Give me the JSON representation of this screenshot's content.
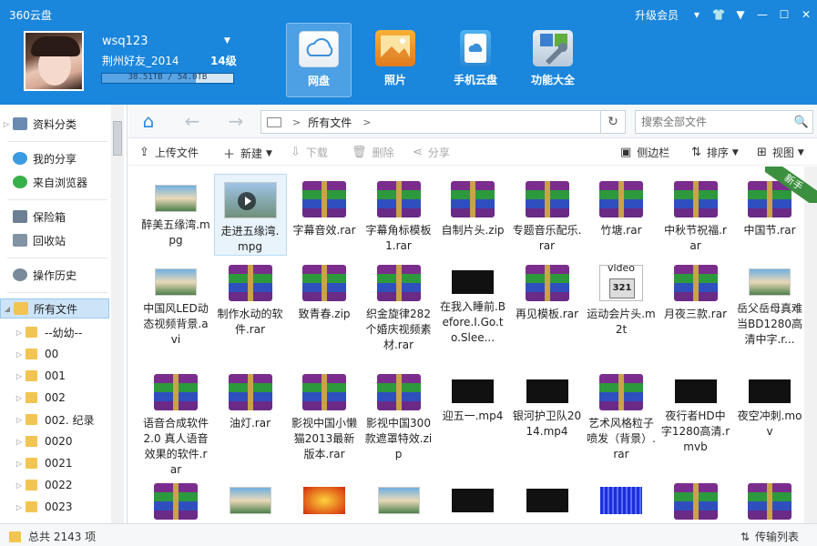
{
  "window": {
    "title": "360云盘",
    "vip_label": "升级会员"
  },
  "colors": {
    "header": "#1a86dc",
    "selection": "#cce4f7"
  },
  "user": {
    "name": "wsq123",
    "group": "荆州好友_2014",
    "level": "14级",
    "quota_text": "38.51TB / 54.0TB",
    "quota_fraction": 0.713
  },
  "main_tabs": [
    {
      "label": "网盘",
      "icon": "cloud-disk-icon",
      "active": true
    },
    {
      "label": "照片",
      "icon": "photo-icon",
      "active": false
    },
    {
      "label": "手机云盘",
      "icon": "phone-cloud-icon",
      "active": false
    },
    {
      "label": "功能大全",
      "icon": "tools-icon",
      "active": false
    }
  ],
  "sidebar": {
    "items": [
      {
        "label": "资料分类",
        "icon": "category-icon"
      },
      {
        "label": "我的分享",
        "icon": "share-icon"
      },
      {
        "label": "来自浏览器",
        "icon": "browser-icon"
      },
      {
        "label": "保险箱",
        "icon": "safe-icon"
      },
      {
        "label": "回收站",
        "icon": "recycle-bin-icon"
      },
      {
        "label": "操作历史",
        "icon": "history-icon"
      },
      {
        "label": "所有文件",
        "icon": "all-files-icon",
        "selected": true
      }
    ],
    "folders": [
      "--幼幼--",
      "00",
      "001",
      "002",
      "002. 纪录",
      "0020",
      "0021",
      "0022",
      "0023"
    ]
  },
  "nav": {
    "path": "所有文件",
    "search_placeholder": "搜索全部文件"
  },
  "toolbar": {
    "upload": "上传文件",
    "new": "新建",
    "download": "下载",
    "delete": "删除",
    "share": "分享",
    "sidebar": "侧边栏",
    "sort": "排序",
    "view": "视图"
  },
  "ribbon": "新手",
  "files": [
    {
      "name": "醉美五缘湾.mpg",
      "thumb": "image"
    },
    {
      "name": "走进五缘湾.mpg",
      "thumb": "video",
      "selected": true
    },
    {
      "name": "字幕音效.rar",
      "thumb": "rar"
    },
    {
      "name": "字幕角标模板1.rar",
      "thumb": "rar"
    },
    {
      "name": "自制片头.zip",
      "thumb": "rar"
    },
    {
      "name": "专题音乐配乐.rar",
      "thumb": "rar"
    },
    {
      "name": "竹塘.rar",
      "thumb": "rar"
    },
    {
      "name": "中秋节祝福.rar",
      "thumb": "rar"
    },
    {
      "name": "中国节.rar",
      "thumb": "rar"
    },
    {
      "name": "中国风LED动态视频背景.avi",
      "thumb": "image"
    },
    {
      "name": "制作水动的软件.rar",
      "thumb": "rar"
    },
    {
      "name": "致青春.zip",
      "thumb": "rar"
    },
    {
      "name": "织金旋律282个婚庆视频素材.rar",
      "thumb": "rar"
    },
    {
      "name": "在我入睡前.Before.I.Go.to.Slee...",
      "thumb": "dark"
    },
    {
      "name": "再见模板.rar",
      "thumb": "rar"
    },
    {
      "name": "运动会片头.m2t",
      "thumb": "video-file"
    },
    {
      "name": "月夜三款.rar",
      "thumb": "rar"
    },
    {
      "name": "岳父岳母真难当BD1280高清中字.r...",
      "thumb": "image"
    },
    {
      "name": "语音合成软件2.0 真人语音效果的软件.rar",
      "thumb": "rar"
    },
    {
      "name": "油灯.rar",
      "thumb": "rar"
    },
    {
      "name": "影视中国小懒猫2013最新版本.rar",
      "thumb": "rar"
    },
    {
      "name": "影视中国300款遮罩特效.zip",
      "thumb": "rar"
    },
    {
      "name": "迎五一.mp4",
      "thumb": "dark"
    },
    {
      "name": "银河护卫队2014.mp4",
      "thumb": "dark"
    },
    {
      "name": "艺术风格粒子喷发（背景）.rar",
      "thumb": "rar"
    },
    {
      "name": "夜行者HD中字1280高清.rmvb",
      "thumb": "dark"
    },
    {
      "name": "夜空冲刺.mov",
      "thumb": "dark"
    },
    {
      "name": "",
      "thumb": "rar"
    },
    {
      "name": "",
      "thumb": "image"
    },
    {
      "name": "",
      "thumb": "red"
    },
    {
      "name": "",
      "thumb": "image"
    },
    {
      "name": "",
      "thumb": "dark"
    },
    {
      "name": "",
      "thumb": "dark"
    },
    {
      "name": "",
      "thumb": "blue"
    },
    {
      "name": "",
      "thumb": "rar"
    },
    {
      "name": "",
      "thumb": "rar"
    }
  ],
  "status": {
    "total_label": "总共 2143 项",
    "transfer_label": "传输列表"
  }
}
